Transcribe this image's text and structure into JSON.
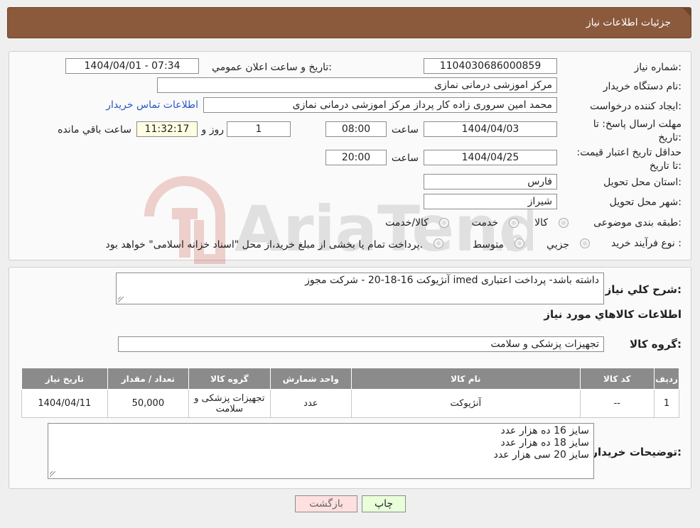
{
  "header": {
    "title": "جزئیات اطلاعات نیاز"
  },
  "form": {
    "need_number_label": "شماره نیاز:",
    "need_number": "1104030686000859",
    "announce_label": "تاریخ و ساعت اعلان عمومي:",
    "announce_value": "1404/04/01 - 07:34",
    "buyer_org_label": "نام دستگاه خريدار:",
    "buyer_org": "مرکز اموزشی درمانی نمازی",
    "creator_label": "ايجاد کننده درخواست:",
    "creator": "محمد امین سروری زاده کار پرداز مرکز اموزشی درمانی نمازی",
    "contact_link": "اطلاعات تماس خريدار",
    "deadline_label": "مهلت ارسال پاسخ: تا تاريخ:",
    "deadline_date": "1404/04/03",
    "time_label": "ساعت",
    "deadline_time": "08:00",
    "days_value": "1",
    "days_label": "روز و",
    "remaining_time": "11:32:17",
    "remaining_label": "ساعت باقي مانده",
    "validity_label": "حداقل تاريخ اعتبار قيمت: تا تاريخ:",
    "validity_date": "1404/04/25",
    "validity_time_label": "ساعت",
    "validity_time": "20:00",
    "province_label": "استان محل تحويل:",
    "province": "فارس",
    "city_label": "شهر محل تحويل:",
    "city": "شيراز",
    "category_label": "طبقه بندی موضوعی:",
    "category_options": [
      "کالا",
      "خدمت",
      "کالا/خدمت"
    ],
    "process_label": "نوع فرآيند خريد :",
    "process_options": [
      "جزيي",
      "متوسط"
    ],
    "process_note": "پرداخت تمام يا بخشی از مبلغ خريد،از محل \"اسناد خزانه اسلامی\" خواهد بود."
  },
  "summary": {
    "label": "شرح کلي نياز:",
    "value": "آنژیوکت 16-18-20 - شرکت مجوز imed داشته باشد- پرداخت اعتباری"
  },
  "goods": {
    "section_title": "اطلاعات کالاهاي مورد نياز",
    "group_label": "گروه کالا:",
    "group_value": "تجهيزات پزشکی و سلامت",
    "columns": [
      "رديف",
      "کد کالا",
      "نام کالا",
      "واحد شمارش",
      "گروه کالا",
      "تعداد / مقدار",
      "تاريخ نياز"
    ],
    "rows": [
      {
        "row": "1",
        "code": "--",
        "name": "آنژیوکت",
        "unit": "عدد",
        "group": "تجهيزات پزشکی و سلامت",
        "qty": "50,000",
        "date": "1404/04/11"
      }
    ]
  },
  "buyer_notes": {
    "label": "توضيحات خريدار:",
    "lines": [
      "سایز 16 ده هزار عدد",
      "سایز 18 ده هزار عدد",
      "سایز 20 سی هزار عدد"
    ]
  },
  "buttons": {
    "print": "چاپ",
    "back": "بازگشت"
  },
  "colors": {
    "header": "#8b5a3c",
    "table_header": "#8b8b8b",
    "print_btn": "#e9ffd9",
    "back_btn": "#ffe0e0",
    "link": "#2a55c8"
  }
}
